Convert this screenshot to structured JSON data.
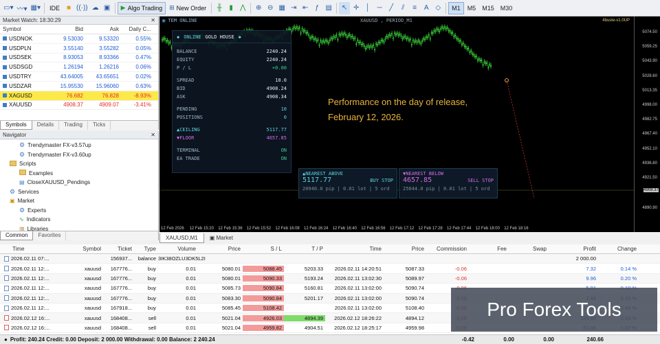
{
  "toolbar": {
    "ide_label": "IDE",
    "algo_trading_label": "Algo Trading",
    "new_order_label": "New Order",
    "timeframes": [
      "M1",
      "M5",
      "M15",
      "M30"
    ],
    "selected_timeframe": "M1"
  },
  "market_watch": {
    "title": "Market Watch: 18:30:29",
    "headers": [
      "Symbol",
      "Bid",
      "Ask",
      "Daily C..."
    ],
    "rows": [
      {
        "symbol": "USDNOK",
        "bid": "9.53030",
        "ask": "9.53320",
        "change": "0.55%"
      },
      {
        "symbol": "USDPLN",
        "bid": "3.55140",
        "ask": "3.55282",
        "change": "0.05%"
      },
      {
        "symbol": "USDSEK",
        "bid": "8.93053",
        "ask": "8.93366",
        "change": "0.47%"
      },
      {
        "symbol": "USDSGD",
        "bid": "1.26194",
        "ask": "1.26216",
        "change": "0.06%"
      },
      {
        "symbol": "USDTRY",
        "bid": "43.64005",
        "ask": "43.65651",
        "change": "0.02%"
      },
      {
        "symbol": "USDZAR",
        "bid": "15.95530",
        "ask": "15.96060",
        "change": "0.63%"
      },
      {
        "symbol": "XAGUSD",
        "bid": "76.682",
        "ask": "76.828",
        "change": "-8.93%"
      },
      {
        "symbol": "XAUUSD",
        "bid": "4908.37",
        "ask": "4909.07",
        "change": "-3.41%"
      }
    ],
    "tabs": [
      "Symbols",
      "Details",
      "Trading",
      "Ticks"
    ]
  },
  "navigator": {
    "title": "Navigator",
    "items": [
      {
        "label": "Trendymaster FX-v3.57up",
        "indent": 2,
        "icon": "ea-icon"
      },
      {
        "label": "Trendymaster FX-v3.60up",
        "indent": 2,
        "icon": "ea-icon"
      },
      {
        "label": "Scripts",
        "indent": 1,
        "icon": "folder-icon"
      },
      {
        "label": "Examples",
        "indent": 2,
        "icon": "folder-icon"
      },
      {
        "label": "CloseXAUUSD_Pendings",
        "indent": 2,
        "icon": "script-icon"
      },
      {
        "label": "Services",
        "indent": 1,
        "icon": "gear-icon"
      },
      {
        "label": "Market",
        "indent": 1,
        "icon": "cart-icon"
      },
      {
        "label": "Experts",
        "indent": 2,
        "icon": "ea-icon"
      },
      {
        "label": "Indicators",
        "indent": 2,
        "icon": "indicator-icon"
      },
      {
        "label": "Libraries",
        "indent": 2,
        "icon": "library-icon"
      }
    ],
    "tabs": [
      "Common",
      "Favorites"
    ]
  },
  "chart": {
    "header": "TEM ONLINE",
    "symbol_period": "XAUUSD , PERIOD_M1",
    "corner_label": "4buste-v1.0UP",
    "caption_line1": "Performance on the day of release,",
    "caption_line2": "February 12, 2026.",
    "price_labels": [
      "5074.50",
      "5059.25",
      "5043.90",
      "5028.60",
      "5013.35",
      "4998.00",
      "4982.75",
      "4967.40",
      "4952.10",
      "4936.80",
      "4921.50",
      "4908.37",
      "4890.90"
    ],
    "time_labels": [
      "12 Feb 2026",
      "12 Feb 15:20",
      "12 Feb 15:36",
      "12 Feb 15:52",
      "12 Feb 16:08",
      "12 Feb 16:24",
      "12 Feb 16:40",
      "12 Feb 16:56",
      "12 Feb 17:12",
      "12 Feb 17:28",
      "12 Feb 17:44",
      "12 Feb 18:00",
      "12 Feb 18:16"
    ],
    "tabs": [
      "XAUUSD,M1",
      "Market"
    ]
  },
  "hud": {
    "status": "ONLINE",
    "name": "GOLD HOUSE",
    "rows": [
      {
        "k": "BALANCE",
        "v": "2240.24"
      },
      {
        "k": "EQUITY",
        "v": "2240.24"
      },
      {
        "k": "P / L",
        "v": "+0.00"
      },
      {
        "k": "SPREAD",
        "v": "10.0"
      },
      {
        "k": "BID",
        "v": "4908.24"
      },
      {
        "k": "ASK",
        "v": "4908.34"
      },
      {
        "k": "PENDING",
        "v": "10"
      },
      {
        "k": "POSITIONS",
        "v": "0"
      },
      {
        "k": "▲CEILING",
        "v": "5117.77"
      },
      {
        "k": "▼FLOOR",
        "v": "4657.85"
      },
      {
        "k": "TERMINAL",
        "v": "ON"
      },
      {
        "k": "EA TRADE",
        "v": "ON"
      }
    ],
    "above": {
      "title": "▲NEAREST ABOVE",
      "price": "5117.77",
      "type": "BUY STOP",
      "detail": "20940.0 pip | 0.01 lot | 5 ord"
    },
    "below": {
      "title": "▼NEAREST BELOW",
      "price": "4657.85",
      "type": "SELL STOP",
      "detail": "25044.0 pip | 0.01 lot | 5 ord"
    }
  },
  "trades": {
    "headers": [
      "Time",
      "Symbol",
      "Ticket",
      "Type",
      "Volume",
      "Price",
      "S / L",
      "T / P",
      "Time",
      "Price",
      "Commission",
      "Fee",
      "Swap",
      "Profit",
      "Change"
    ],
    "rows": [
      {
        "time": "2026.02.11 07:...",
        "symbol": "",
        "ticket": "156937...",
        "type": "balance",
        "volume": "3IK38OZLU3DK5L2I",
        "price": "",
        "sl": "",
        "tp": "",
        "time2": "",
        "price2": "",
        "comm": "",
        "fee": "",
        "swap": "",
        "profit": "2 000.00",
        "change": ""
      },
      {
        "time": "2026.02.11 12:...",
        "symbol": "xauusd",
        "ticket": "167776...",
        "type": "buy",
        "volume": "0.01",
        "price": "5080.01",
        "sl": "5088.45",
        "tp": "5203.33",
        "time2": "2026.02.11 14:20:51",
        "price2": "5087.33",
        "comm": "-0.06",
        "fee": "",
        "swap": "",
        "profit": "7.32",
        "change": "0.14 %"
      },
      {
        "time": "2026.02.11 12:...",
        "symbol": "xauusd",
        "ticket": "167776...",
        "type": "buy",
        "volume": "0.01",
        "price": "5080.01",
        "sl": "5090.33",
        "tp": "5193.24",
        "time2": "2026.02.11 13:02:30",
        "price2": "5089.97",
        "comm": "-0.06",
        "fee": "",
        "swap": "",
        "profit": "9.96",
        "change": "0.20 %"
      },
      {
        "time": "2026.02.11 12:...",
        "symbol": "xauusd",
        "ticket": "167776...",
        "type": "buy",
        "volume": "0.01",
        "price": "5085.73",
        "sl": "5090.84",
        "tp": "5160.81",
        "time2": "2026.02.11 13:02:00",
        "price2": "5090.74",
        "comm": "-0.06",
        "fee": "",
        "swap": "",
        "profit": "5.01",
        "change": "0.10 %"
      },
      {
        "time": "2026.02.11 12:...",
        "symbol": "xauusd",
        "ticket": "167776...",
        "type": "buy",
        "volume": "0.01",
        "price": "5083.30",
        "sl": "5090.84",
        "tp": "5201.17",
        "time2": "2026.02.11 13:02:00",
        "price2": "5090.74",
        "comm": "-0.06",
        "fee": "",
        "swap": "",
        "profit": "7.44",
        "change": "0.15 %"
      },
      {
        "time": "2026.02.11 12:...",
        "symbol": "xauusd",
        "ticket": "167918...",
        "type": "buy",
        "volume": "0.01",
        "price": "5085.45",
        "sl": "5108.42",
        "tp": "",
        "time2": "2026.02.11 13:02:00",
        "price2": "5108.40",
        "comm": "-0.06",
        "fee": "",
        "swap": "",
        "profit": "22.95",
        "change": "0.45 %"
      },
      {
        "time": "2026.02.12 16:...",
        "symbol": "xauusd",
        "ticket": "168408...",
        "type": "sell",
        "volume": "0.01",
        "price": "5021.04",
        "sl": "4926.03",
        "tp": "4894.39",
        "time2": "2026.02.12 18:26:22",
        "price2": "4894.12",
        "comm": "-0.06",
        "fee": "",
        "swap": "",
        "profit": "126.92",
        "change": "2.53 %"
      },
      {
        "time": "2026.02.12 16:...",
        "symbol": "xauusd",
        "ticket": "168408...",
        "type": "sell",
        "volume": "0.01",
        "price": "5021.04",
        "sl": "4959.82",
        "tp": "4904.51",
        "time2": "2026.02.12 18:25:17",
        "price2": "4959.98",
        "comm": "-0.06",
        "fee": "",
        "swap": "",
        "profit": "61.06",
        "change": "1.22 %"
      }
    ],
    "footer": {
      "summary": "Profit: 240.24  Credit: 0.00  Deposit: 2 000.00  Withdrawal: 0.00  Balance: 2 240.24",
      "comm": "-0.42",
      "fee": "0.00",
      "swap": "0.00",
      "profit": "240.66"
    }
  },
  "watermark": "Pro Forex Tools"
}
